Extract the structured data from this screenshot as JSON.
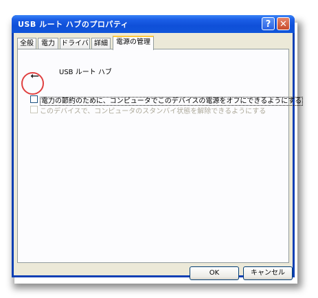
{
  "window": {
    "title": "USB ルート ハブのプロパティ",
    "help_icon": "?",
    "close_icon": "✕"
  },
  "tabs": [
    {
      "label": "全般",
      "active": false
    },
    {
      "label": "電力",
      "active": false
    },
    {
      "label": "ドライバ",
      "active": false
    },
    {
      "label": "詳細",
      "active": false
    },
    {
      "label": "電源の管理",
      "active": true
    }
  ],
  "device": {
    "name": "USB ルート ハブ",
    "icon": "usb-icon"
  },
  "options": [
    {
      "label": "電力の節約のために、コンピュータでこのデバイスの電源をオフにできるようにする",
      "checked": false,
      "enabled": true
    },
    {
      "label": "このデバイスで、コンピュータのスタンバイ状態を解除できるようにする",
      "checked": false,
      "enabled": false
    }
  ],
  "buttons": {
    "ok": "OK",
    "cancel": "キャンセル"
  },
  "colors": {
    "titlebar": "#0f4fd8",
    "highlight_circle": "#e04040",
    "active_tab_accent": "#ffc83c"
  }
}
